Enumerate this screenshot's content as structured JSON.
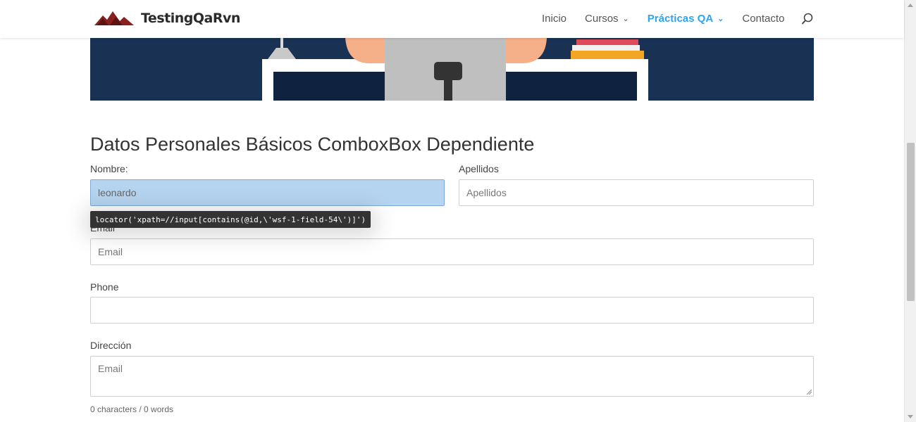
{
  "header": {
    "logo_text": "TestingQaRvn",
    "nav": [
      {
        "label": "Inicio",
        "dropdown": false,
        "active": false
      },
      {
        "label": "Cursos",
        "dropdown": true,
        "active": false
      },
      {
        "label": "Prácticas QA",
        "dropdown": true,
        "active": true
      },
      {
        "label": "Contacto",
        "dropdown": false,
        "active": false
      }
    ],
    "search_icon": "search-icon"
  },
  "colors": {
    "accent": "#2ea3f2",
    "hero_bg": "#193254",
    "highlight": "#b5d4f0"
  },
  "form": {
    "title": "Datos Personales Básicos ComboxBox Dependiente",
    "nombre": {
      "label": "Nombre:",
      "value": "leonardo"
    },
    "apellidos": {
      "label": "Apellidos",
      "placeholder": "Apellidos"
    },
    "email": {
      "label": "Email",
      "placeholder": "Email"
    },
    "phone": {
      "label": "Phone",
      "value": ""
    },
    "direccion": {
      "label": "Dirección",
      "placeholder": "Email"
    },
    "counter": "0 characters / 0 words"
  },
  "tooltip": {
    "text": "locator('xpath=//input[contains(@id,\\'wsf-1-field-54\\')]')"
  }
}
